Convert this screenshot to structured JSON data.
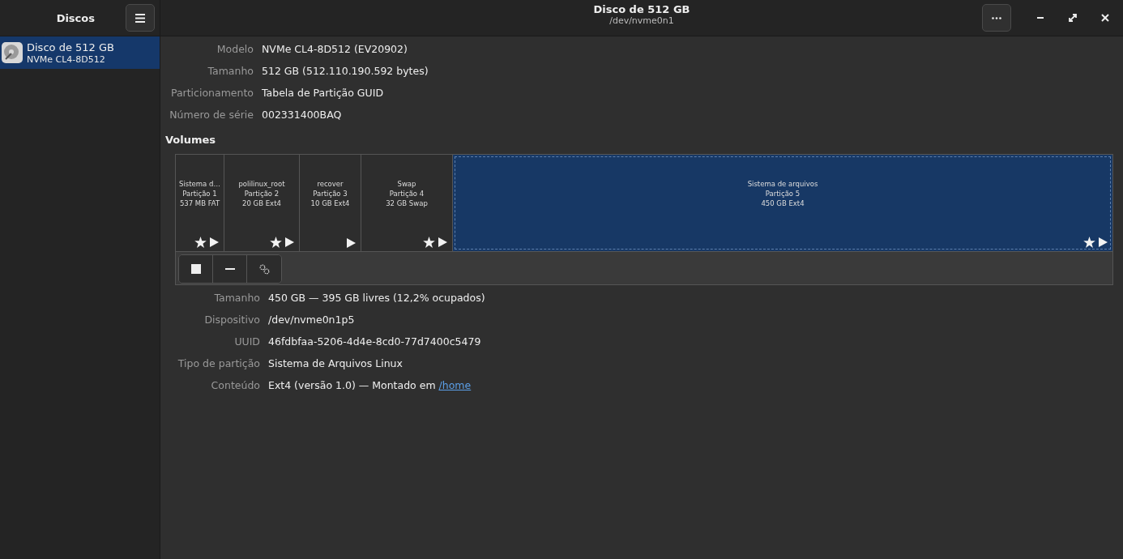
{
  "sidebar": {
    "title": "Discos",
    "items": [
      {
        "name": "Disco de 512 GB",
        "subtitle": "NVMe CL4-8D512",
        "selected": true
      }
    ]
  },
  "window": {
    "title": "Disco de 512 GB",
    "subtitle": "/dev/nvme0n1"
  },
  "disk_info": [
    {
      "label": "Modelo",
      "value": "NVMe CL4-8D512 (EV20902)"
    },
    {
      "label": "Tamanho",
      "value": "512 GB (512.110.190.592 bytes)"
    },
    {
      "label": "Particionamento",
      "value": "Tabela de Partição GUID"
    },
    {
      "label": "Número de série",
      "value": "002331400BAQ"
    }
  ],
  "volumes": {
    "title": "Volumes",
    "partitions": [
      {
        "name": "Sistema d…",
        "number": "Partição 1",
        "size": "537 MB FAT",
        "star": true,
        "selected": false
      },
      {
        "name": "polilinux_root",
        "number": "Partição 2",
        "size": "20 GB Ext4",
        "star": true,
        "selected": false
      },
      {
        "name": "recover",
        "number": "Partição 3",
        "size": "10 GB Ext4",
        "star": false,
        "selected": false
      },
      {
        "name": "Swap",
        "number": "Partição 4",
        "size": "32 GB Swap",
        "star": true,
        "selected": false
      },
      {
        "name": "Sistema de arquivos",
        "number": "Partição 5",
        "size": "450 GB Ext4",
        "star": true,
        "selected": true
      }
    ]
  },
  "volume_info": [
    {
      "label": "Tamanho",
      "value": "450 GB — 395 GB livres (12,2% ocupados)"
    },
    {
      "label": "Dispositivo",
      "value": "/dev/nvme0n1p5"
    },
    {
      "label": "UUID",
      "value": "46fdbfaa-5206-4d4e-8cd0-77d7400c5479"
    },
    {
      "label": "Tipo de partição",
      "value": "Sistema de Arquivos Linux"
    },
    {
      "label": "Conteúdo",
      "value": "Ext4 (versão 1.0) — Montado em",
      "link": "/home"
    }
  ]
}
